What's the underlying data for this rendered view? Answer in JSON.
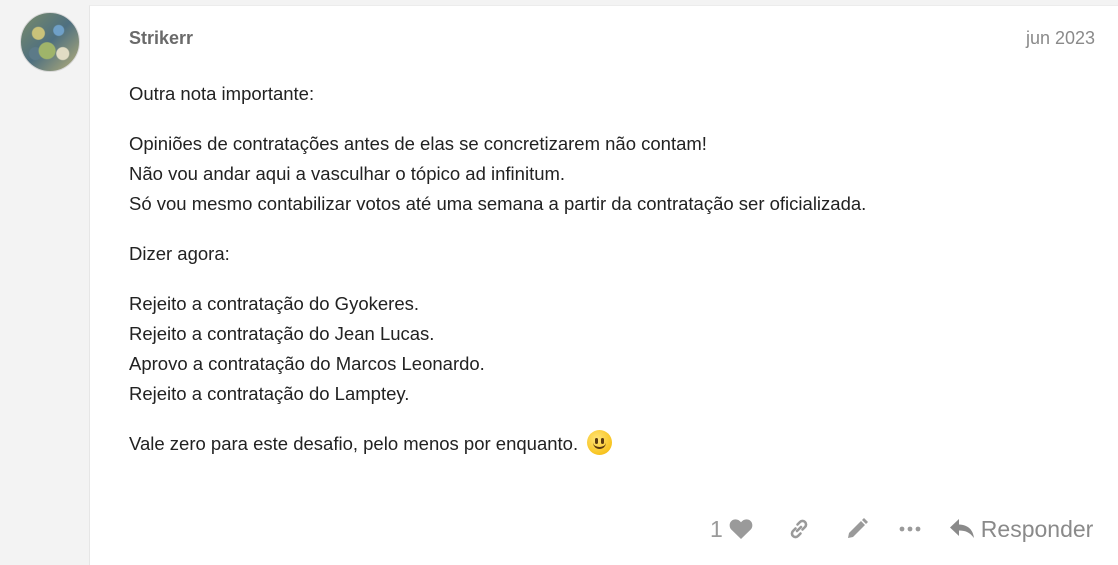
{
  "post": {
    "username": "Strikerr",
    "date": "jun 2023",
    "paragraphs": [
      "Outra nota importante:",
      "Opiniões de contratações antes de elas se concretizarem não contam!",
      "Não vou andar aqui a vasculhar o tópico ad infinitum.",
      "Só vou mesmo contabilizar votos até uma semana a partir da contratação ser oficializada.",
      "Dizer agora:",
      "Rejeito a contratação do Gyokeres.",
      "Rejeito a contratação do Jean Lucas.",
      "Aprovo a contratação do Marcos Leonardo.",
      "Rejeito a contratação do Lamptey.",
      "Vale zero para este desafio, pelo menos por enquanto."
    ],
    "emoji": "slightly-smiling-face"
  },
  "actions": {
    "like_count": "1",
    "like_icon": "heart-icon",
    "link_icon": "link-icon",
    "edit_icon": "pencil-icon",
    "more_icon": "ellipsis-icon",
    "reply_icon": "reply-icon",
    "reply_label": "Responder"
  },
  "colors": {
    "background": "#f3f3f3",
    "card": "#ffffff",
    "text": "#222222",
    "muted": "#8a8a8a"
  }
}
